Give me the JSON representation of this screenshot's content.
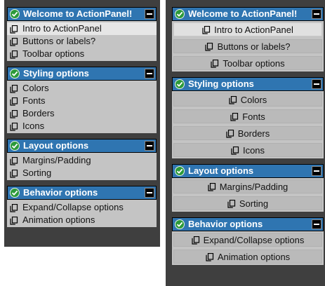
{
  "left": {
    "groups": [
      {
        "title": "Welcome to ActionPanel!",
        "items": [
          {
            "label": "Intro to ActionPanel",
            "selected": true
          },
          {
            "label": "Buttons or labels?"
          },
          {
            "label": "Toolbar options"
          }
        ]
      },
      {
        "title": "Styling options",
        "items": [
          {
            "label": "Colors"
          },
          {
            "label": "Fonts"
          },
          {
            "label": "Borders"
          },
          {
            "label": "Icons"
          }
        ]
      },
      {
        "title": "Layout options",
        "items": [
          {
            "label": "Margins/Padding"
          },
          {
            "label": "Sorting"
          }
        ]
      },
      {
        "title": "Behavior options",
        "items": [
          {
            "label": "Expand/Collapse options"
          },
          {
            "label": "Animation options"
          }
        ]
      }
    ]
  },
  "right": {
    "groups": [
      {
        "title": "Welcome to ActionPanel!",
        "items": [
          {
            "label": "Intro to ActionPanel",
            "selected": true
          },
          {
            "label": "Buttons or labels?"
          },
          {
            "label": "Toolbar options"
          }
        ]
      },
      {
        "title": "Styling options",
        "items": [
          {
            "label": "Colors"
          },
          {
            "label": "Fonts"
          },
          {
            "label": "Borders"
          },
          {
            "label": "Icons"
          }
        ]
      },
      {
        "title": "Layout options",
        "items": [
          {
            "label": "Margins/Padding"
          },
          {
            "label": "Sorting"
          }
        ]
      },
      {
        "title": "Behavior options",
        "items": [
          {
            "label": "Expand/Collapse options"
          },
          {
            "label": "Animation options"
          }
        ]
      }
    ]
  },
  "icons": {
    "header_left": "check-circle-icon",
    "header_right": "collapse-icon",
    "item": "copy-document-icon"
  },
  "colors": {
    "header_bg": "#2f75b1",
    "panel_bg": "#3f3f3f",
    "body_bg": "#c4c4c4",
    "check_green": "#2c9a3a"
  }
}
